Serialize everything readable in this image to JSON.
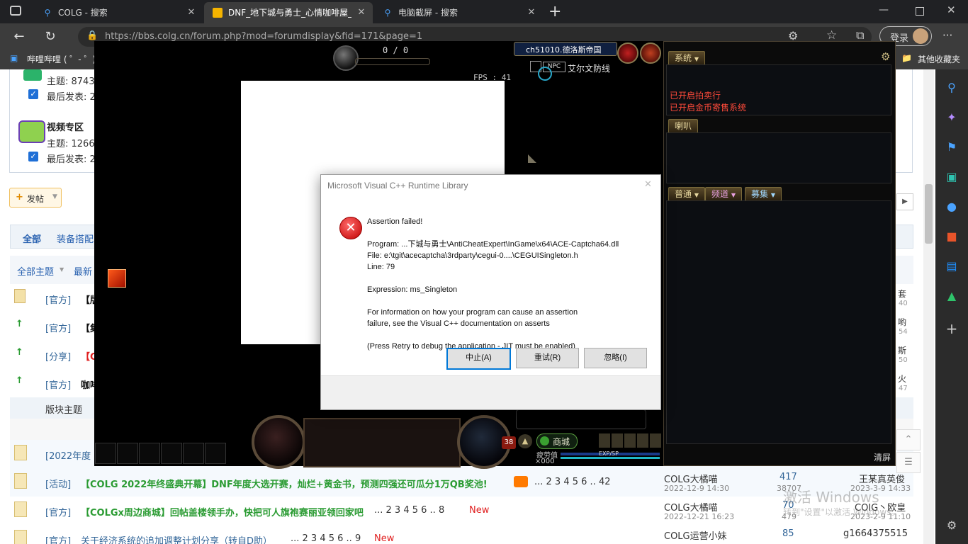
{
  "tabs": [
    {
      "label": "COLG - 搜索",
      "icon": "search-icon"
    },
    {
      "label": "DNF_地下城与勇士_心情咖啡屋_",
      "icon": "forum-icon"
    },
    {
      "label": "电脑截屏 - 搜索",
      "icon": "search-icon"
    }
  ],
  "browser": {
    "url": "https://bbs.colg.cn/forum.php?mod=forumdisplay&fid=171&page=1",
    "login_label": "登录",
    "more_label": "···",
    "bookmark_left": "哔哩哔哩 ( ゜- ゜)つ",
    "bookmark_right": "其他收藏夹"
  },
  "forum": {
    "board1": {
      "count": "主题: 8743",
      "last": "最后发表: 2"
    },
    "board2": {
      "name": "视频专区",
      "count": "主题: 1266",
      "last": "最后发表: 2"
    },
    "post_button": "发帖",
    "cat_tabs": [
      "全部",
      "装备搭配"
    ],
    "filter": [
      "全部主题",
      "最新"
    ],
    "thread_tags": [
      "[官方]",
      "[官方]",
      "[分享]",
      "[官方]"
    ],
    "thread_titles": [
      "【版",
      "【集",
      "【C",
      "咖啡"
    ],
    "right_names": [
      "套",
      "哟",
      "斯",
      "火"
    ],
    "right_times": [
      "40",
      "54",
      "50",
      "47"
    ],
    "board_topic": "版块主题",
    "cut_title": "[2022年度",
    "rows": [
      {
        "tag": "[活动]",
        "title": "【COLG 2022年终盛典开幕】DNF年度大选开赛，灿烂+黄金书，预测四强还可瓜分1万QB奖池!",
        "pages": "... 2  3  4  5  6 .. 42",
        "author": "COLG大橘喵",
        "date": "2022-12-9 14:30",
        "replies": "417",
        "views": "38707",
        "last_user": "王某真英俊",
        "last_time": "2023-3-9 14:33"
      },
      {
        "tag": "[官方]",
        "title": "【COLGx周边商城】回帖盖楼领手办，快把可人旗袍赛丽亚领回家吧",
        "pages": "... 2  3  4  5  6 .. 8",
        "new_tag": "New",
        "author": "COLG大橘喵",
        "date": "2022-12-21 16:23",
        "replies": "70",
        "views": "479",
        "last_user": "COIG丶欧皇",
        "last_time": "2023-2-9 11:10"
      },
      {
        "tag": "[官方]",
        "title": "关于经济系统的追加调整计划分享（转自D助）",
        "pages": "... 2  3  4  5  6 .. 9",
        "new_tag": "New",
        "author": "COLG运营小妹",
        "replies": "85",
        "last_user": "g1664375515"
      }
    ],
    "watermark_1": "激活 Windows",
    "watermark_2": "转到\"设置\"以激活 Windows。"
  },
  "game": {
    "counter": "0 / 0",
    "fps": "FPS : 41",
    "channel": "ch51010.德洛斯帝国",
    "npc_tag": "NPC",
    "location": "艾尔文防线",
    "level": "38",
    "shop_label": "商城",
    "fatigue_label": "疲劳值",
    "gold": "×000",
    "exp_label": "EXP/SP",
    "chat": {
      "system_tab": "系统",
      "system_lines": [
        "已开启拍卖行",
        "已开启金币寄售系统"
      ],
      "horn_tab": "喇叭",
      "normal_tab": "普通",
      "channel_tab": "频道",
      "recruit_tab": "募集",
      "clear_label": "清屏"
    }
  },
  "dialog": {
    "title": "Microsoft Visual C++ Runtime Library",
    "heading": "Assertion failed!",
    "program": "Program: ...下城与勇士\\AntiCheatExpert\\InGame\\x64\\ACE-Captcha64.dll",
    "file": "File: e:\\tgit\\acecaptcha\\3rdparty\\cegui-0....\\CEGUISingleton.h",
    "line": "Line: 79",
    "expression": "Expression: ms_Singleton",
    "info1": "For information on how your program can cause an assertion",
    "info2": "failure, see the Visual C++ documentation on asserts",
    "retry_note": "(Press Retry to debug the application - JIT must be enabled)",
    "abort_label": "中止(A)",
    "retry_label": "重试(R)",
    "ignore_label": "忽略(I)"
  }
}
